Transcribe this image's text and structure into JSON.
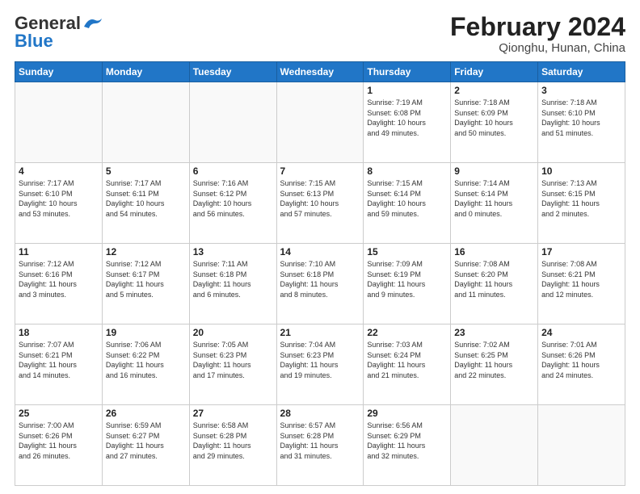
{
  "header": {
    "logo_line1": "General",
    "logo_line2": "Blue",
    "main_title": "February 2024",
    "subtitle": "Qionghu, Hunan, China"
  },
  "weekdays": [
    "Sunday",
    "Monday",
    "Tuesday",
    "Wednesday",
    "Thursday",
    "Friday",
    "Saturday"
  ],
  "weeks": [
    [
      {
        "day": "",
        "info": ""
      },
      {
        "day": "",
        "info": ""
      },
      {
        "day": "",
        "info": ""
      },
      {
        "day": "",
        "info": ""
      },
      {
        "day": "1",
        "info": "Sunrise: 7:19 AM\nSunset: 6:08 PM\nDaylight: 10 hours\nand 49 minutes."
      },
      {
        "day": "2",
        "info": "Sunrise: 7:18 AM\nSunset: 6:09 PM\nDaylight: 10 hours\nand 50 minutes."
      },
      {
        "day": "3",
        "info": "Sunrise: 7:18 AM\nSunset: 6:10 PM\nDaylight: 10 hours\nand 51 minutes."
      }
    ],
    [
      {
        "day": "4",
        "info": "Sunrise: 7:17 AM\nSunset: 6:10 PM\nDaylight: 10 hours\nand 53 minutes."
      },
      {
        "day": "5",
        "info": "Sunrise: 7:17 AM\nSunset: 6:11 PM\nDaylight: 10 hours\nand 54 minutes."
      },
      {
        "day": "6",
        "info": "Sunrise: 7:16 AM\nSunset: 6:12 PM\nDaylight: 10 hours\nand 56 minutes."
      },
      {
        "day": "7",
        "info": "Sunrise: 7:15 AM\nSunset: 6:13 PM\nDaylight: 10 hours\nand 57 minutes."
      },
      {
        "day": "8",
        "info": "Sunrise: 7:15 AM\nSunset: 6:14 PM\nDaylight: 10 hours\nand 59 minutes."
      },
      {
        "day": "9",
        "info": "Sunrise: 7:14 AM\nSunset: 6:14 PM\nDaylight: 11 hours\nand 0 minutes."
      },
      {
        "day": "10",
        "info": "Sunrise: 7:13 AM\nSunset: 6:15 PM\nDaylight: 11 hours\nand 2 minutes."
      }
    ],
    [
      {
        "day": "11",
        "info": "Sunrise: 7:12 AM\nSunset: 6:16 PM\nDaylight: 11 hours\nand 3 minutes."
      },
      {
        "day": "12",
        "info": "Sunrise: 7:12 AM\nSunset: 6:17 PM\nDaylight: 11 hours\nand 5 minutes."
      },
      {
        "day": "13",
        "info": "Sunrise: 7:11 AM\nSunset: 6:18 PM\nDaylight: 11 hours\nand 6 minutes."
      },
      {
        "day": "14",
        "info": "Sunrise: 7:10 AM\nSunset: 6:18 PM\nDaylight: 11 hours\nand 8 minutes."
      },
      {
        "day": "15",
        "info": "Sunrise: 7:09 AM\nSunset: 6:19 PM\nDaylight: 11 hours\nand 9 minutes."
      },
      {
        "day": "16",
        "info": "Sunrise: 7:08 AM\nSunset: 6:20 PM\nDaylight: 11 hours\nand 11 minutes."
      },
      {
        "day": "17",
        "info": "Sunrise: 7:08 AM\nSunset: 6:21 PM\nDaylight: 11 hours\nand 12 minutes."
      }
    ],
    [
      {
        "day": "18",
        "info": "Sunrise: 7:07 AM\nSunset: 6:21 PM\nDaylight: 11 hours\nand 14 minutes."
      },
      {
        "day": "19",
        "info": "Sunrise: 7:06 AM\nSunset: 6:22 PM\nDaylight: 11 hours\nand 16 minutes."
      },
      {
        "day": "20",
        "info": "Sunrise: 7:05 AM\nSunset: 6:23 PM\nDaylight: 11 hours\nand 17 minutes."
      },
      {
        "day": "21",
        "info": "Sunrise: 7:04 AM\nSunset: 6:23 PM\nDaylight: 11 hours\nand 19 minutes."
      },
      {
        "day": "22",
        "info": "Sunrise: 7:03 AM\nSunset: 6:24 PM\nDaylight: 11 hours\nand 21 minutes."
      },
      {
        "day": "23",
        "info": "Sunrise: 7:02 AM\nSunset: 6:25 PM\nDaylight: 11 hours\nand 22 minutes."
      },
      {
        "day": "24",
        "info": "Sunrise: 7:01 AM\nSunset: 6:26 PM\nDaylight: 11 hours\nand 24 minutes."
      }
    ],
    [
      {
        "day": "25",
        "info": "Sunrise: 7:00 AM\nSunset: 6:26 PM\nDaylight: 11 hours\nand 26 minutes."
      },
      {
        "day": "26",
        "info": "Sunrise: 6:59 AM\nSunset: 6:27 PM\nDaylight: 11 hours\nand 27 minutes."
      },
      {
        "day": "27",
        "info": "Sunrise: 6:58 AM\nSunset: 6:28 PM\nDaylight: 11 hours\nand 29 minutes."
      },
      {
        "day": "28",
        "info": "Sunrise: 6:57 AM\nSunset: 6:28 PM\nDaylight: 11 hours\nand 31 minutes."
      },
      {
        "day": "29",
        "info": "Sunrise: 6:56 AM\nSunset: 6:29 PM\nDaylight: 11 hours\nand 32 minutes."
      },
      {
        "day": "",
        "info": ""
      },
      {
        "day": "",
        "info": ""
      }
    ]
  ]
}
